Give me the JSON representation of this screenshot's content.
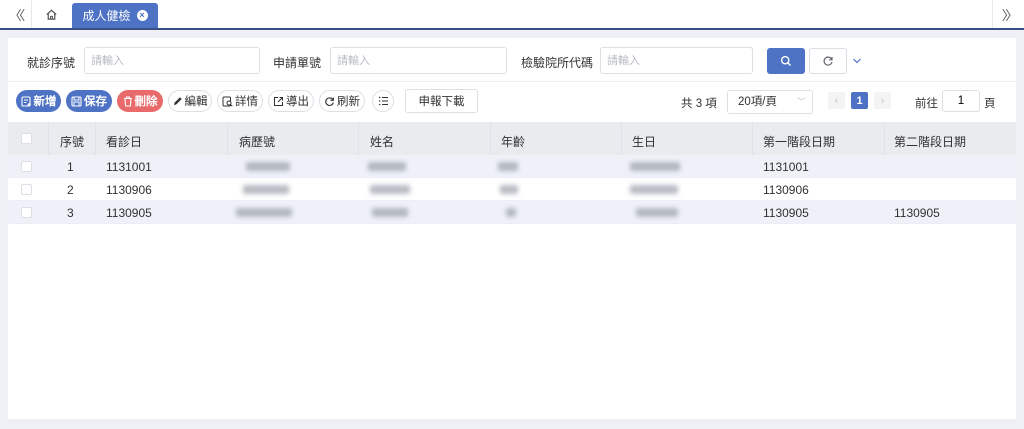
{
  "tabbar": {
    "active_tab": "成人健檢"
  },
  "search": {
    "fields": [
      {
        "label": "就診序號",
        "placeholder": "請輸入"
      },
      {
        "label": "申請單號",
        "placeholder": "請輸入"
      },
      {
        "label": "檢驗院所代碼",
        "placeholder": "請輸入"
      }
    ]
  },
  "toolbar": {
    "add": "新增",
    "save": "保存",
    "delete": "刪除",
    "edit": "編輯",
    "detail": "詳情",
    "export": "導出",
    "refresh": "刷新",
    "report_download": "申報下載"
  },
  "pagination": {
    "total": "共 3 項",
    "page_size": "20項/頁",
    "current_page": "1",
    "goto_label": "前往",
    "goto_value": "1",
    "goto_unit": "頁"
  },
  "table": {
    "headers": [
      "序號",
      "看診日",
      "病歷號",
      "姓名",
      "年齡",
      "生日",
      "第一階段日期",
      "第二階段日期"
    ],
    "rows": [
      {
        "seq": "1",
        "visit_date": "1131001",
        "stage1": "1131001",
        "stage2": ""
      },
      {
        "seq": "2",
        "visit_date": "1130906",
        "stage1": "1130906",
        "stage2": ""
      },
      {
        "seq": "3",
        "visit_date": "1130905",
        "stage1": "1130905",
        "stage2": "1130905"
      }
    ]
  },
  "colors": {
    "accent": "#4e72c4",
    "danger": "#e86a6a",
    "header_bg": "#e9ebef",
    "stripe_bg": "#eef1f7"
  }
}
